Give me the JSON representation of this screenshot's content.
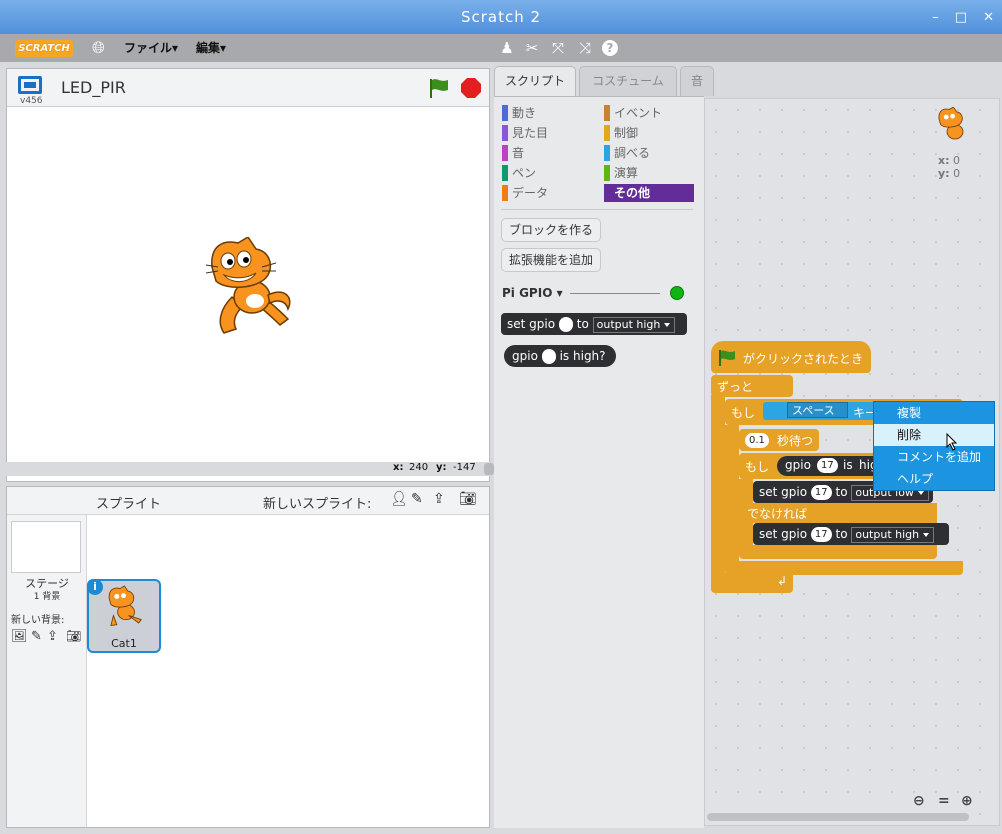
{
  "window": {
    "title": "Scratch 2",
    "minimize": "–",
    "maximize": "□",
    "close": "✕"
  },
  "menubar": {
    "logo": "SCRATCH",
    "file": "ファイル▾",
    "edit": "編集▾"
  },
  "stage": {
    "version": "v456",
    "project_title": "LED_PIR",
    "coords_x_label": "x:",
    "coords_x": "240",
    "coords_y_label": "y:",
    "coords_y": "-147"
  },
  "sprites": {
    "header": "スプライト",
    "new_sprite_label": "新しいスプライト:",
    "stage_label": "ステージ",
    "backdrop_count": "1 背景",
    "new_backdrop_label": "新しい背景:",
    "items": [
      {
        "name": "Cat1"
      }
    ]
  },
  "tabs": [
    {
      "label": "スクリプト"
    },
    {
      "label": "コスチューム"
    },
    {
      "label": "音"
    }
  ],
  "categories": [
    {
      "label": "動き",
      "color": "#4a6cd4"
    },
    {
      "label": "イベント",
      "color": "#c88330"
    },
    {
      "label": "見た目",
      "color": "#8a55d7"
    },
    {
      "label": "制御",
      "color": "#e1a91a"
    },
    {
      "label": "音",
      "color": "#bb42c3"
    },
    {
      "label": "調べる",
      "color": "#2ca5e2"
    },
    {
      "label": "ペン",
      "color": "#0e9a6c"
    },
    {
      "label": "演算",
      "color": "#5cb712"
    },
    {
      "label": "データ",
      "color": "#ee7d16"
    },
    {
      "label": "その他",
      "color": "#632d99"
    }
  ],
  "palette": {
    "make_block": "ブロックを作る",
    "add_extension": "拡張機能を追加",
    "extension_name": "Pi GPIO ▾",
    "block_set": {
      "set": "set",
      "gpio": "gpio",
      "to": "to",
      "mode": "output high"
    },
    "block_is": {
      "gpio": "gpio",
      "is": "is",
      "high": "high?"
    }
  },
  "sprite_info": {
    "x_label": "x:",
    "x": "0",
    "y_label": "y:",
    "y": "0"
  },
  "script": {
    "hat": "がクリックされたとき",
    "forever": "ずっと",
    "if1": "もし",
    "key": "スペース",
    "key_pressed": "キーが押",
    "wait_val": "0.1",
    "wait": "秒待つ",
    "if2": "もし",
    "gpio": "gpio",
    "pin": "17",
    "is": "is",
    "high": "high",
    "set": "set",
    "to": "to",
    "output_low": "output low",
    "output_high": "output high",
    "else": "でなければ"
  },
  "context_menu": [
    "複製",
    "削除",
    "コメントを追加",
    "ヘルプ"
  ]
}
